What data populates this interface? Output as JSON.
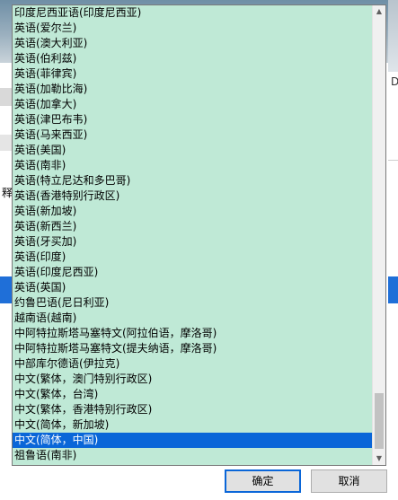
{
  "dropdown": {
    "items": [
      {
        "label": "印度尼西亚语(印度尼西亚)",
        "selected": false
      },
      {
        "label": "英语(爱尔兰)",
        "selected": false
      },
      {
        "label": "英语(澳大利亚)",
        "selected": false
      },
      {
        "label": "英语(伯利兹)",
        "selected": false
      },
      {
        "label": "英语(菲律宾)",
        "selected": false
      },
      {
        "label": "英语(加勒比海)",
        "selected": false
      },
      {
        "label": "英语(加拿大)",
        "selected": false
      },
      {
        "label": "英语(津巴布韦)",
        "selected": false
      },
      {
        "label": "英语(马来西亚)",
        "selected": false
      },
      {
        "label": "英语(美国)",
        "selected": false
      },
      {
        "label": "英语(南非)",
        "selected": false
      },
      {
        "label": "英语(特立尼达和多巴哥)",
        "selected": false
      },
      {
        "label": "英语(香港特别行政区)",
        "selected": false
      },
      {
        "label": "英语(新加坡)",
        "selected": false
      },
      {
        "label": "英语(新西兰)",
        "selected": false
      },
      {
        "label": "英语(牙买加)",
        "selected": false
      },
      {
        "label": "英语(印度)",
        "selected": false
      },
      {
        "label": "英语(印度尼西亚)",
        "selected": false
      },
      {
        "label": "英语(英国)",
        "selected": false
      },
      {
        "label": "约鲁巴语(尼日利亚)",
        "selected": false
      },
      {
        "label": "越南语(越南)",
        "selected": false
      },
      {
        "label": "中阿特拉斯塔马塞特文(阿拉伯语，摩洛哥)",
        "selected": false
      },
      {
        "label": "中阿特拉斯塔马塞特文(提夫纳语，摩洛哥)",
        "selected": false
      },
      {
        "label": "中部库尔德语(伊拉克)",
        "selected": false
      },
      {
        "label": "中文(繁体，澳门特别行政区)",
        "selected": false
      },
      {
        "label": "中文(繁体，台湾)",
        "selected": false
      },
      {
        "label": "中文(繁体，香港特别行政区)",
        "selected": false
      },
      {
        "label": "中文(简体，新加坡)",
        "selected": false
      },
      {
        "label": "中文(简体，中国)",
        "selected": true
      },
      {
        "label": "祖鲁语(南非)",
        "selected": false
      }
    ]
  },
  "scrollbar": {
    "up_glyph": "▲",
    "down_glyph": "▼"
  },
  "background": {
    "left_fragment": "释",
    "right_fragment": "D"
  },
  "buttons": {
    "ok_label": "确定",
    "cancel_label": "取消"
  },
  "colors": {
    "list_bg": "#bfe9d6",
    "selection": "#0a66d8",
    "ok_border": "#0a66d8"
  }
}
